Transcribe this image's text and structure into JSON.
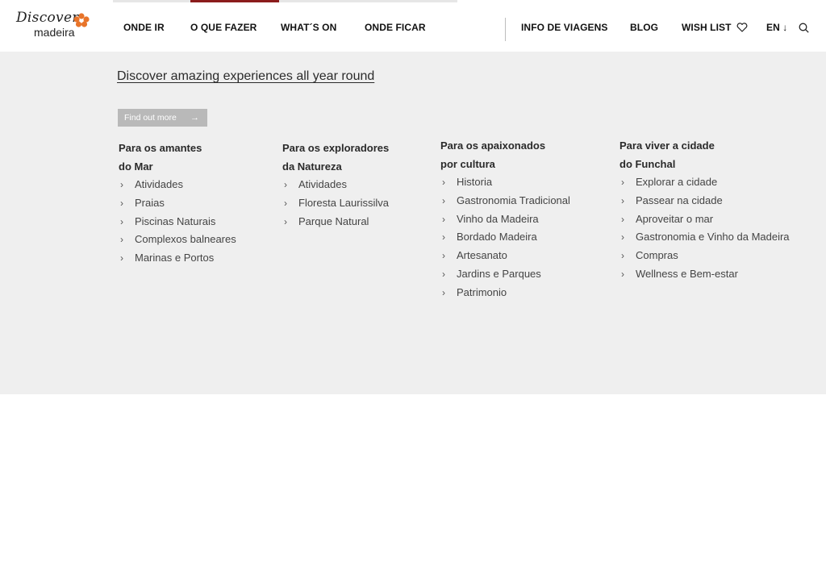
{
  "logo": {
    "script": "Discover",
    "sub": "madeira"
  },
  "nav": {
    "main": [
      {
        "label": "ONDE IR"
      },
      {
        "label": "O QUE FAZER"
      },
      {
        "label": "WHAT´S ON"
      },
      {
        "label": "ONDE FICAR"
      }
    ],
    "right": {
      "info": "INFO DE VIAGENS",
      "blog": "BLOG",
      "wishlist": "WISH LIST",
      "lang": "EN ↓"
    }
  },
  "promo": {
    "title": "Discover amazing experiences all year round",
    "button": "Find out more",
    "button_arrow": "→"
  },
  "columns": [
    {
      "heading_line1": "Para os amantes",
      "heading_line2": "do Mar",
      "items": [
        "Atividades",
        "Praias",
        "Piscinas Naturais",
        "Complexos balneares",
        "Marinas e Portos"
      ]
    },
    {
      "heading_line1": "Para os exploradores",
      "heading_line2": "da Natureza",
      "items": [
        "Atividades",
        "Floresta Laurissilva",
        "Parque Natural"
      ]
    },
    {
      "heading_line1": "Para os apaixonados",
      "heading_line2": "por cultura",
      "items": [
        "Historia",
        "Gastronomia Tradicional",
        "Vinho da Madeira",
        "Bordado Madeira",
        "Artesanato",
        "Jardins e Parques",
        "Patrimonio"
      ]
    },
    {
      "heading_line1": "Para viver a cidade",
      "heading_line2": "do Funchal",
      "items": [
        "Explorar a cidade",
        "Passear na cidade",
        "Aproveitar o mar",
        "Gastronomia e Vinho da Madeira",
        "Compras",
        "Wellness e Bem-estar"
      ]
    }
  ],
  "colors": {
    "accent": "#8b1c1c",
    "panel": "#efefef",
    "button": "#b9b9b9",
    "logo_orange": "#e8742a"
  },
  "icons": {
    "wishlist": "heart-outline-icon",
    "search": "search-icon",
    "chevron": "chevron-right-icon",
    "logo": "flower-logo-icon"
  }
}
